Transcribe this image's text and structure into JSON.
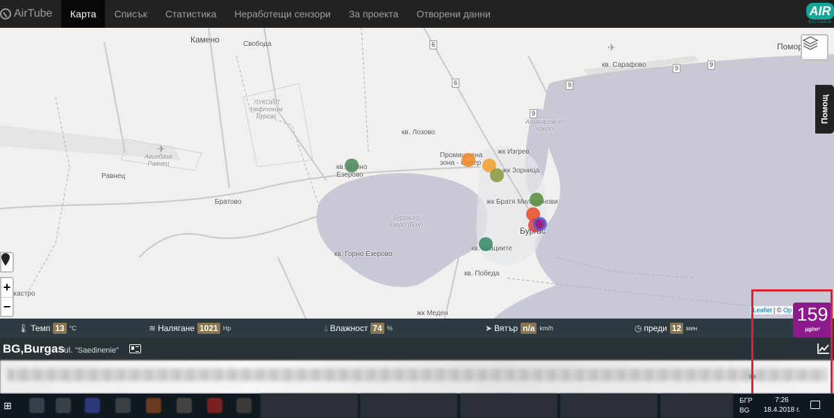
{
  "navbar": {
    "brand": "AirTube",
    "items": [
      {
        "label": "Карта",
        "active": true
      },
      {
        "label": "Списък",
        "active": false
      },
      {
        "label": "Статистика",
        "active": false
      },
      {
        "label": "Неработещи сензори",
        "active": false
      },
      {
        "label": "За проекта",
        "active": false
      },
      {
        "label": "Отворени данни",
        "active": false
      }
    ],
    "logo_text": "AIR",
    "logo_sub": "BULGARIA"
  },
  "map": {
    "labels": {
      "kameno": "Камено",
      "svoboda": "Свобода",
      "lukoil": "ЛУКОЙЛ\nНефтохим\nБургас",
      "lozovo": "кв. Лозово",
      "avio": "Авиобаза\nРавнец",
      "ravnets": "Равнец",
      "dolno_ezerovo": "кв. Долно\nЕзерово",
      "bratovo": "Братово",
      "burgasko_ezero": "Бургаско\nезеро (Вая)",
      "gorno_ezerovo": "кв. Горно Езерово",
      "promishlena": "Промишлена\nзона - Север",
      "izgrev": "жк Изгрев",
      "zornitsa": "жк Зорница",
      "bratya": "жк Братя Миладинови",
      "burgas": "Бургас",
      "akatsii": "кв. Акациите",
      "pobeda": "кв. Победа",
      "meden": "жк Меден\nрудник",
      "sarafovo": "кв. Сарафово",
      "pomorie": "Помор",
      "atanasovsko": "Атанасовско\nезеро",
      "krastro": "ркастро"
    },
    "road_shields": [
      "6",
      "6",
      "9",
      "9",
      "9",
      "9"
    ],
    "help_label": "Помощ",
    "zoom_in": "+",
    "zoom_out": "−",
    "attribution_link": "Leaflet",
    "attribution_sep": " | © ",
    "attribution_tail": "Op",
    "markers": [
      {
        "name": "dolno-ezerovo",
        "color": "#4e8a5a"
      },
      {
        "name": "promishlena-1",
        "color": "#f08a2a"
      },
      {
        "name": "promishlena-2",
        "color": "#f0a030"
      },
      {
        "name": "zornitsa",
        "color": "#8a9a40"
      },
      {
        "name": "bratya",
        "color": "#5a9040"
      },
      {
        "name": "center-1",
        "color": "#e8502a"
      },
      {
        "name": "center-2",
        "color": "#e04040"
      },
      {
        "name": "center-selected",
        "color": "#8b1a8c"
      },
      {
        "name": "akatsii",
        "color": "#3a8a6a"
      }
    ]
  },
  "stats": {
    "temp_label": "Темп",
    "temp_value": "13",
    "temp_unit": "°C",
    "pressure_label": "Налягане",
    "pressure_value": "1021",
    "pressure_unit": "Hp",
    "humidity_label": "Влажност",
    "humidity_value": "74",
    "humidity_unit": "%",
    "wind_label": "Вятър",
    "wind_value": "n/a",
    "wind_unit": "km/h",
    "ago_label": "преди",
    "ago_value": "12",
    "ago_unit": "мин"
  },
  "location": {
    "city": "BG,Burgas",
    "street_prefix": "ul.",
    "street": "\"Saedinenie\""
  },
  "pm": {
    "value": "159",
    "unit": "µg/m³"
  },
  "blurred_right": "ва",
  "taskbar": {
    "lang": "БГР\nBG",
    "time": "7:26",
    "date": "18.4.2018 г."
  }
}
